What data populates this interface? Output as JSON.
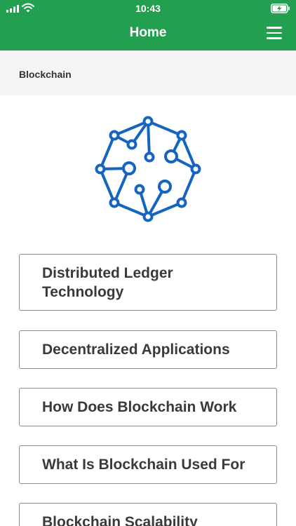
{
  "status_bar": {
    "time": "10:43"
  },
  "header": {
    "title": "Home"
  },
  "breadcrumb": {
    "label": "Blockchain"
  },
  "topics": [
    {
      "label": "Distributed Ledger Technology"
    },
    {
      "label": "Decentralized Applications"
    },
    {
      "label": "How Does Blockchain Work"
    },
    {
      "label": "What Is Blockchain Used For"
    },
    {
      "label": "Blockchain Scalability"
    }
  ],
  "colors": {
    "header_bg": "#23a04f",
    "logo_blue": "#1565c0",
    "text": "#3a3a3a"
  },
  "icons": [
    "signal-icon",
    "wifi-icon",
    "battery-charging-icon",
    "hamburger-menu-icon",
    "blockchain-logo"
  ]
}
